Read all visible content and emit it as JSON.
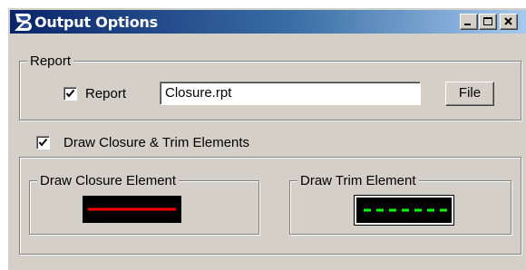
{
  "window": {
    "title": "Output Options",
    "controls": {
      "minimize": "minimize-icon",
      "maximize": "maximize-icon",
      "close": "close-icon"
    }
  },
  "report_group": {
    "legend": "Report",
    "checkbox_label": "Report",
    "checked": true,
    "file_value": "Closure.rpt",
    "file_button_label": "File"
  },
  "draw_option": {
    "label": "Draw Closure & Trim Elements",
    "checked": true
  },
  "closure_group": {
    "legend": "Draw Closure Element",
    "line_color": "#ff0000",
    "line_style": "solid"
  },
  "trim_group": {
    "legend": "Draw Trim Element",
    "line_color": "#00ff00",
    "line_style": "dashed"
  },
  "colors": {
    "title_gradient_start": "#0a246a",
    "title_gradient_end": "#a6caf0",
    "dialog_face": "#d4d0c8"
  }
}
